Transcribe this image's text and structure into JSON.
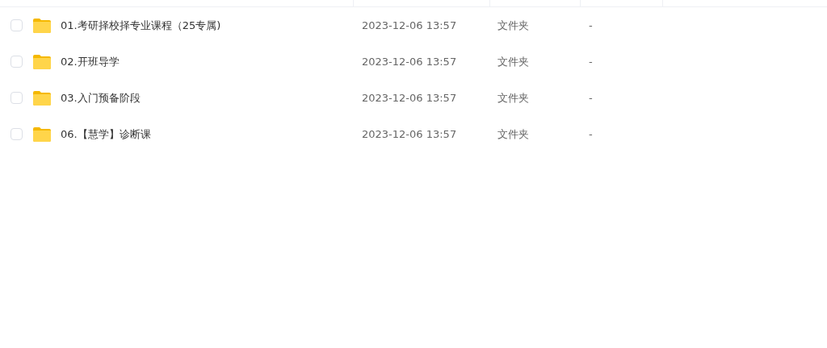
{
  "files": [
    {
      "name": "01.考研择校择专业课程（25专属)",
      "modified": "2023-12-06 13:57",
      "type": "文件夹",
      "size": "-",
      "checked": false
    },
    {
      "name": "02.开班导学",
      "modified": "2023-12-06 13:57",
      "type": "文件夹",
      "size": "-",
      "checked": false
    },
    {
      "name": "03.入门预备阶段",
      "modified": "2023-12-06 13:57",
      "type": "文件夹",
      "size": "-",
      "checked": false
    },
    {
      "name": "06.【慧学】诊断课",
      "modified": "2023-12-06 13:57",
      "type": "文件夹",
      "size": "-",
      "checked": false
    }
  ]
}
